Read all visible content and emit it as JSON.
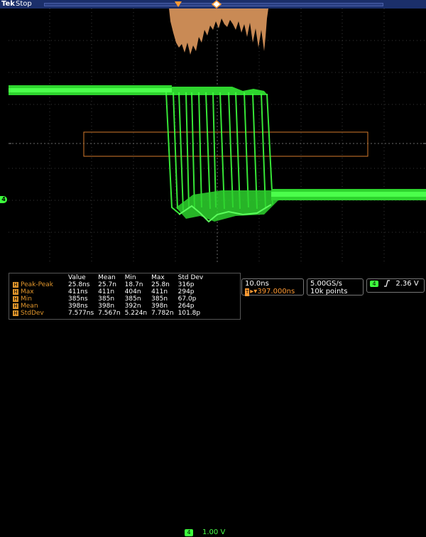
{
  "header": {
    "brand": "Tek",
    "status": "Stop"
  },
  "channel": {
    "marker": "4",
    "scale": "1.00 V",
    "color": "#3dff3d"
  },
  "measurements": {
    "columns": [
      "Value",
      "Mean",
      "Min",
      "Max",
      "Std Dev"
    ],
    "rows": [
      {
        "label": "Peak-Peak",
        "value": "25.8ns",
        "mean": "25.7n",
        "min": "18.7n",
        "max": "25.8n",
        "std": "316p"
      },
      {
        "label": "Max",
        "value": "411ns",
        "mean": "411n",
        "min": "404n",
        "max": "411n",
        "std": "294p"
      },
      {
        "label": "Min",
        "value": "385ns",
        "mean": "385n",
        "min": "385n",
        "max": "385n",
        "std": "67.0p"
      },
      {
        "label": "Mean",
        "value": "398ns",
        "mean": "398n",
        "min": "392n",
        "max": "398n",
        "std": "264p"
      },
      {
        "label": "StdDev",
        "value": "7.577ns",
        "mean": "7.567n",
        "min": "5.224n",
        "max": "7.782n",
        "std": "101.8p"
      }
    ],
    "row_badge": "H"
  },
  "horizontal": {
    "timebase": "10.0ns",
    "delay": "397.000ns",
    "delay_badge": "T"
  },
  "acquisition": {
    "sample_rate": "5.00GS/s",
    "record_length": "10k points"
  },
  "trigger": {
    "channel": "4",
    "slope_icon": "rising-edge",
    "level": "2.36 V"
  },
  "colors": {
    "trace": "#3dff3d",
    "histogram": "#c98a55",
    "measure_accent": "#e0952b",
    "header": "#1b2f6a"
  }
}
